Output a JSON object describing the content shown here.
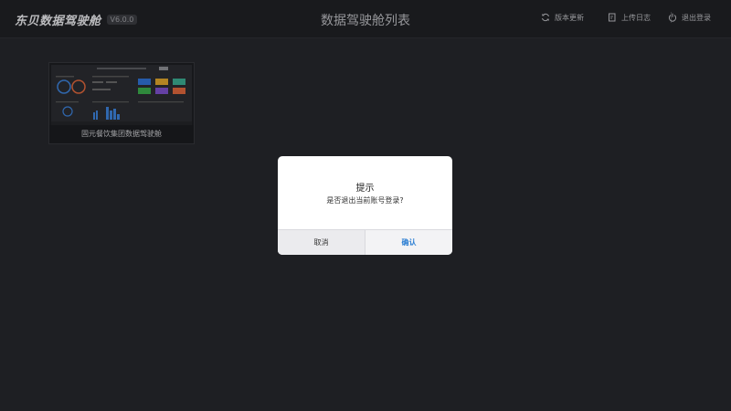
{
  "header": {
    "brand": "东贝数据驾驶舱",
    "version": "V6.0.0",
    "title": "数据驾驶舱列表",
    "actions": {
      "update": "版本更新",
      "upload_log": "上传日志",
      "logout": "退出登录"
    }
  },
  "cards": [
    {
      "label": "固元餐饮集团数据驾驶舱"
    }
  ],
  "dialog": {
    "title": "提示",
    "message": "是否退出当前账号登录?",
    "cancel": "取消",
    "confirm": "确认"
  },
  "colors": {
    "background": "#25262b",
    "header": "#1f2024",
    "accent": "#2d7fd3"
  }
}
